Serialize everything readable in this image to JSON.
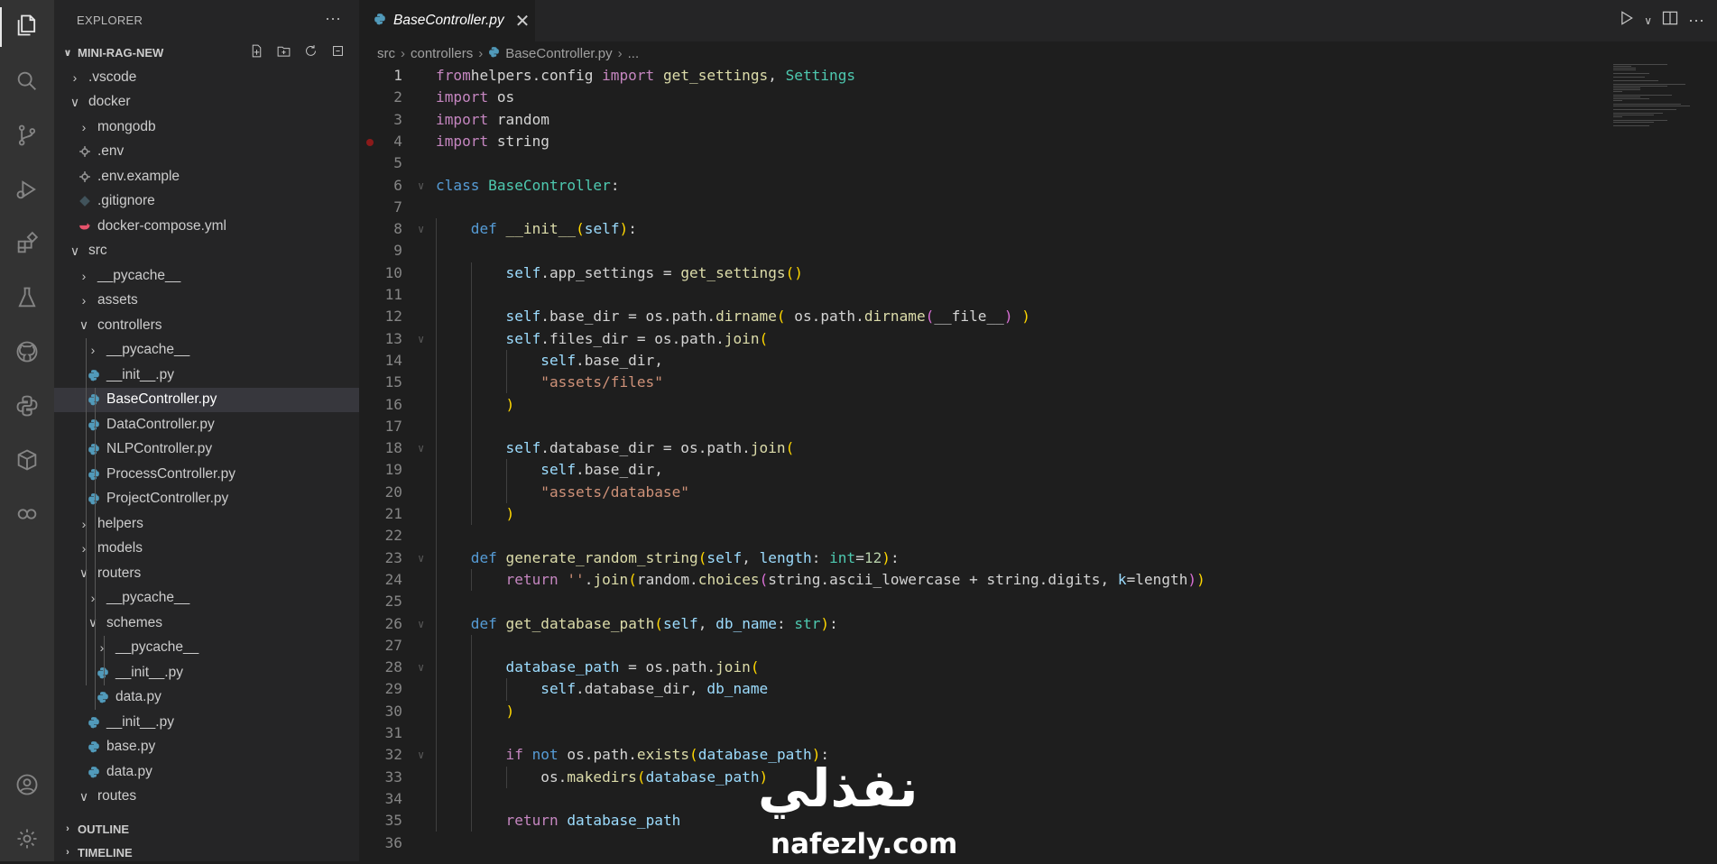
{
  "sidebar": {
    "title": "EXPLORER",
    "more_label": "···",
    "project": "MINI-RAG-NEW",
    "outline": "OUTLINE",
    "timeline": "TIMELINE",
    "tree": [
      {
        "label": ".vscode",
        "type": "folder",
        "open": false,
        "depth": 0
      },
      {
        "label": "docker",
        "type": "folder",
        "open": true,
        "depth": 0
      },
      {
        "label": "mongodb",
        "type": "folder",
        "open": false,
        "depth": 1
      },
      {
        "label": ".env",
        "type": "gear",
        "depth": 1
      },
      {
        "label": ".env.example",
        "type": "gear",
        "depth": 1
      },
      {
        "label": ".gitignore",
        "type": "git",
        "depth": 1
      },
      {
        "label": "docker-compose.yml",
        "type": "docker",
        "depth": 1
      },
      {
        "label": "src",
        "type": "folder",
        "open": true,
        "depth": 0
      },
      {
        "label": "__pycache__",
        "type": "folder",
        "open": false,
        "depth": 1
      },
      {
        "label": "assets",
        "type": "folder",
        "open": false,
        "depth": 1
      },
      {
        "label": "controllers",
        "type": "folder",
        "open": true,
        "depth": 1
      },
      {
        "label": "__pycache__",
        "type": "folder",
        "open": false,
        "depth": 2
      },
      {
        "label": "__init__.py",
        "type": "python",
        "depth": 2
      },
      {
        "label": "BaseController.py",
        "type": "python",
        "depth": 2,
        "selected": true
      },
      {
        "label": "DataController.py",
        "type": "python",
        "depth": 2
      },
      {
        "label": "NLPController.py",
        "type": "python",
        "depth": 2
      },
      {
        "label": "ProcessController.py",
        "type": "python",
        "depth": 2
      },
      {
        "label": "ProjectController.py",
        "type": "python",
        "depth": 2
      },
      {
        "label": "helpers",
        "type": "folder",
        "open": false,
        "depth": 1
      },
      {
        "label": "models",
        "type": "folder",
        "open": false,
        "depth": 1
      },
      {
        "label": "routers",
        "type": "folder",
        "open": true,
        "depth": 1
      },
      {
        "label": "__pycache__",
        "type": "folder",
        "open": false,
        "depth": 2
      },
      {
        "label": "schemes",
        "type": "folder",
        "open": true,
        "depth": 2
      },
      {
        "label": "__pycache__",
        "type": "folder",
        "open": false,
        "depth": 3
      },
      {
        "label": "__init__.py",
        "type": "python",
        "depth": 3
      },
      {
        "label": "data.py",
        "type": "python",
        "depth": 3
      },
      {
        "label": "__init__.py",
        "type": "python",
        "depth": 2
      },
      {
        "label": "base.py",
        "type": "python",
        "depth": 2
      },
      {
        "label": "data.py",
        "type": "python",
        "depth": 2
      },
      {
        "label": "routes",
        "type": "folder",
        "open": true,
        "depth": 1
      }
    ]
  },
  "editor": {
    "tab_label": "BaseController.py",
    "breadcrumb": [
      "src",
      "controllers",
      "BaseController.py",
      "..."
    ],
    "current_line": 1,
    "breakpoint_line": 4,
    "lines": [
      [
        [
          "kw-purple",
          "from"
        ],
        [
          "",
          "helpers.config "
        ],
        [
          "kw-purple",
          "import"
        ],
        [
          "fn",
          " get_settings"
        ],
        [
          "",
          ", "
        ],
        [
          "cls",
          "Settings"
        ]
      ],
      [
        [
          "kw-purple",
          "import"
        ],
        [
          "",
          " os"
        ]
      ],
      [
        [
          "kw-purple",
          "import"
        ],
        [
          "",
          " random"
        ]
      ],
      [
        [
          "kw-purple",
          "import"
        ],
        [
          "",
          " string"
        ]
      ],
      [],
      [
        [
          "kw-blue",
          "class"
        ],
        [
          "",
          " "
        ],
        [
          "cls",
          "BaseController"
        ],
        [
          "",
          ":"
        ]
      ],
      [],
      [
        [
          "",
          "    "
        ],
        [
          "kw-blue",
          "def"
        ],
        [
          "",
          " "
        ],
        [
          "fn",
          "__init__"
        ],
        [
          "br1",
          "("
        ],
        [
          "self",
          "self"
        ],
        [
          "br1",
          ")"
        ],
        [
          "",
          ":"
        ]
      ],
      [],
      [
        [
          "",
          "        "
        ],
        [
          "self",
          "self"
        ],
        [
          "",
          ".app_settings = "
        ],
        [
          "fn",
          "get_settings"
        ],
        [
          "br1",
          "()"
        ]
      ],
      [],
      [
        [
          "",
          "        "
        ],
        [
          "self",
          "self"
        ],
        [
          "",
          ".base_dir = os.path."
        ],
        [
          "fn",
          "dirname"
        ],
        [
          "br1",
          "("
        ],
        [
          "",
          " os.path."
        ],
        [
          "fn",
          "dirname"
        ],
        [
          "br2",
          "("
        ],
        [
          "",
          "__file__"
        ],
        [
          "br2",
          ")"
        ],
        [
          "",
          " "
        ],
        [
          "br1",
          ")"
        ]
      ],
      [
        [
          "",
          "        "
        ],
        [
          "self",
          "self"
        ],
        [
          "",
          ".files_dir = os.path."
        ],
        [
          "fn",
          "join"
        ],
        [
          "br1",
          "("
        ]
      ],
      [
        [
          "",
          "            "
        ],
        [
          "self",
          "self"
        ],
        [
          "",
          ".base_dir,"
        ]
      ],
      [
        [
          "",
          "            "
        ],
        [
          "str",
          "\"assets/files\""
        ]
      ],
      [
        [
          "",
          "        "
        ],
        [
          "br1",
          ")"
        ]
      ],
      [],
      [
        [
          "",
          "        "
        ],
        [
          "self",
          "self"
        ],
        [
          "",
          ".database_dir = os.path."
        ],
        [
          "fn",
          "join"
        ],
        [
          "br1",
          "("
        ]
      ],
      [
        [
          "",
          "            "
        ],
        [
          "self",
          "self"
        ],
        [
          "",
          ".base_dir,"
        ]
      ],
      [
        [
          "",
          "            "
        ],
        [
          "str",
          "\"assets/database\""
        ]
      ],
      [
        [
          "",
          "        "
        ],
        [
          "br1",
          ")"
        ]
      ],
      [],
      [
        [
          "",
          "    "
        ],
        [
          "kw-blue",
          "def"
        ],
        [
          "",
          " "
        ],
        [
          "fn",
          "generate_random_string"
        ],
        [
          "br1",
          "("
        ],
        [
          "self",
          "self"
        ],
        [
          "",
          ", "
        ],
        [
          "param",
          "length"
        ],
        [
          "",
          ": "
        ],
        [
          "cls",
          "int"
        ],
        [
          "",
          "="
        ],
        [
          "num",
          "12"
        ],
        [
          "br1",
          ")"
        ],
        [
          "",
          ":"
        ]
      ],
      [
        [
          "",
          "        "
        ],
        [
          "kw-purple",
          "return"
        ],
        [
          "",
          " "
        ],
        [
          "str",
          "''"
        ],
        [
          "",
          "."
        ],
        [
          "fn",
          "join"
        ],
        [
          "br1",
          "("
        ],
        [
          "",
          "random."
        ],
        [
          "fn",
          "choices"
        ],
        [
          "br2",
          "("
        ],
        [
          "",
          "string.ascii_lowercase + string.digits, "
        ],
        [
          "param",
          "k"
        ],
        [
          "",
          "=length"
        ],
        [
          "br2",
          ")"
        ],
        [
          "br1",
          ")"
        ]
      ],
      [],
      [
        [
          "",
          "    "
        ],
        [
          "kw-blue",
          "def"
        ],
        [
          "",
          " "
        ],
        [
          "fn",
          "get_database_path"
        ],
        [
          "br1",
          "("
        ],
        [
          "self",
          "self"
        ],
        [
          "",
          ", "
        ],
        [
          "param",
          "db_name"
        ],
        [
          "",
          ": "
        ],
        [
          "cls",
          "str"
        ],
        [
          "br1",
          ")"
        ],
        [
          "",
          ":"
        ]
      ],
      [],
      [
        [
          "",
          "        "
        ],
        [
          "var",
          "database_path"
        ],
        [
          "",
          " = os.path."
        ],
        [
          "fn",
          "join"
        ],
        [
          "br1",
          "("
        ]
      ],
      [
        [
          "",
          "            "
        ],
        [
          "self",
          "self"
        ],
        [
          "",
          ".database_dir, "
        ],
        [
          "var",
          "db_name"
        ]
      ],
      [
        [
          "",
          "        "
        ],
        [
          "br1",
          ")"
        ]
      ],
      [],
      [
        [
          "",
          "        "
        ],
        [
          "kw-purple",
          "if"
        ],
        [
          "",
          " "
        ],
        [
          "kw-blue",
          "not"
        ],
        [
          "",
          " os.path."
        ],
        [
          "fn",
          "exists"
        ],
        [
          "br1",
          "("
        ],
        [
          "var",
          "database_path"
        ],
        [
          "br1",
          ")"
        ],
        [
          "",
          ":"
        ]
      ],
      [
        [
          "",
          "            "
        ],
        [
          "",
          "os."
        ],
        [
          "fn",
          "makedirs"
        ],
        [
          "br1",
          "("
        ],
        [
          "var",
          "database_path"
        ],
        [
          "br1",
          ")"
        ]
      ],
      [],
      [
        [
          "",
          "        "
        ],
        [
          "kw-purple",
          "return"
        ],
        [
          "",
          " "
        ],
        [
          "var",
          "database_path"
        ]
      ],
      []
    ]
  },
  "watermark": {
    "arabic": "نفذلي",
    "latin": "nafezly.com"
  },
  "colors": {
    "activity_bar": "#333333",
    "sidebar": "#252526",
    "editor": "#1e1e1e",
    "selected_row": "#37373d",
    "python_icon": "#519aba"
  }
}
